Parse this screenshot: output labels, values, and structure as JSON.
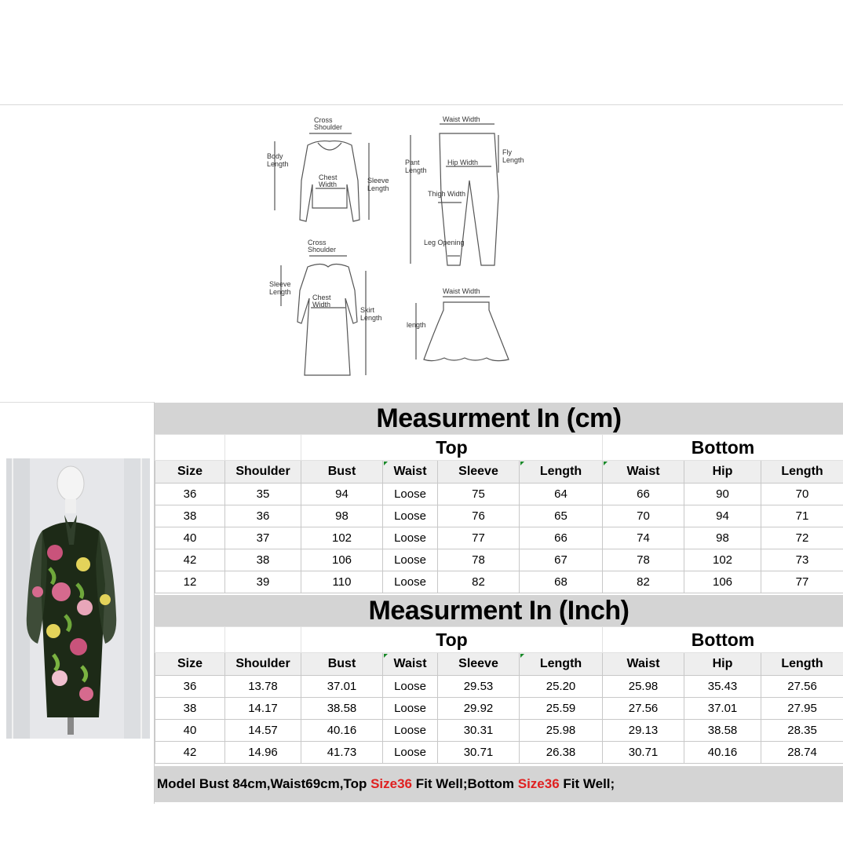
{
  "diagram_labels": {
    "cross_shoulder": [
      "Cross",
      "Shoulder"
    ],
    "body_length": [
      "Body",
      "Length"
    ],
    "chest_width": [
      "Chest",
      "Width"
    ],
    "sleeve_length": [
      "Sleeve",
      "Length"
    ],
    "waist_width": "Waist Width",
    "pant_length": [
      "Pant",
      "Length"
    ],
    "hip_width": "Hip Width",
    "fly_length": [
      "Fly",
      "Length"
    ],
    "thigh_width": "Thigh Width",
    "leg_opening": "Leg Opening",
    "skirt_length": [
      "Skirt",
      "Length"
    ],
    "length": "length"
  },
  "cm_table": {
    "title": "Measurment In (cm)",
    "group_top": "Top",
    "group_bottom": "Bottom",
    "headers": [
      "Size",
      "Shoulder",
      "Bust",
      "Waist",
      "Sleeve",
      "Length",
      "Waist",
      "Hip",
      "Length"
    ],
    "rows": [
      [
        "36",
        "35",
        "94",
        "Loose",
        "75",
        "64",
        "66",
        "90",
        "70"
      ],
      [
        "38",
        "36",
        "98",
        "Loose",
        "76",
        "65",
        "70",
        "94",
        "71"
      ],
      [
        "40",
        "37",
        "102",
        "Loose",
        "77",
        "66",
        "74",
        "98",
        "72"
      ],
      [
        "42",
        "38",
        "106",
        "Loose",
        "78",
        "67",
        "78",
        "102",
        "73"
      ],
      [
        "12",
        "39",
        "110",
        "Loose",
        "82",
        "68",
        "82",
        "106",
        "77"
      ]
    ]
  },
  "inch_table": {
    "title": "Measurment In (Inch)",
    "group_top": "Top",
    "group_bottom": "Bottom",
    "headers": [
      "Size",
      "Shoulder",
      "Bust",
      "Waist",
      "Sleeve",
      "Length",
      "Waist",
      "Hip",
      "Length"
    ],
    "rows": [
      [
        "36",
        "13.78",
        "37.01",
        "Loose",
        "29.53",
        "25.20",
        "25.98",
        "35.43",
        "27.56"
      ],
      [
        "38",
        "14.17",
        "38.58",
        "Loose",
        "29.92",
        "25.59",
        "27.56",
        "37.01",
        "27.95"
      ],
      [
        "40",
        "14.57",
        "40.16",
        "Loose",
        "30.31",
        "25.98",
        "29.13",
        "38.58",
        "28.35"
      ],
      [
        "42",
        "14.96",
        "41.73",
        "Loose",
        "30.71",
        "26.38",
        "30.71",
        "40.16",
        "28.74"
      ]
    ]
  },
  "footer": {
    "part1": "Model Bust 84cm,Waist69cm,Top ",
    "size1": "Size36",
    "part2": " Fit Well;Bottom ",
    "size2": "Size36",
    "part3": " Fit Well;"
  },
  "colors": {
    "header_bg": "#d4d4d4",
    "accent_red": "#e02020",
    "corner_mark": "#1a8a2a"
  }
}
